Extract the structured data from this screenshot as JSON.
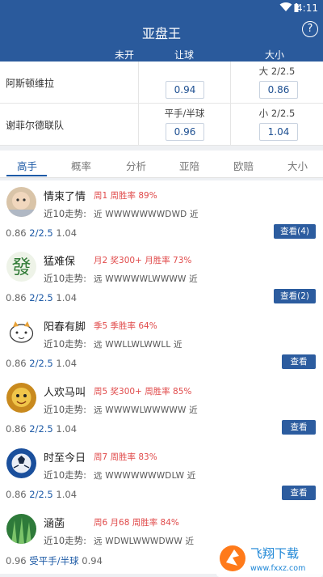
{
  "status": {
    "time": "4:11"
  },
  "app": {
    "title": "亚盘王",
    "help": "?"
  },
  "odds_table": {
    "headers": {
      "not_started": "未开",
      "handicap": "让球",
      "over_under": "大小"
    },
    "rows": [
      {
        "team": "阿斯顿维拉",
        "handicap_label": "",
        "handicap_value": "0.94",
        "ou_label": "大 2/2.5",
        "ou_value": "0.86"
      },
      {
        "team": "谢菲尔德联队",
        "handicap_label": "平手/半球",
        "handicap_value": "0.96",
        "ou_label": "小 2/2.5",
        "ou_value": "1.04"
      }
    ]
  },
  "tabs": [
    {
      "label": "高手",
      "active": true
    },
    {
      "label": "概率",
      "active": false
    },
    {
      "label": "分析",
      "active": false
    },
    {
      "label": "亚陪",
      "active": false
    },
    {
      "label": "欧赔",
      "active": false
    },
    {
      "label": "大小",
      "active": false
    }
  ],
  "experts": [
    {
      "name": "情束了情",
      "record": "周1 周胜率 89%",
      "trend_label": "近10走势:",
      "trend": "近 WWWWWWWDWD 近",
      "odds_left": "0.86",
      "odds_mid": "2/2.5",
      "odds_right": "1.04",
      "button": "查看(4)"
    },
    {
      "name": "猛难保",
      "record": "月2 奖300+ 月胜率 73%",
      "trend_label": "近10走势:",
      "trend": "远 WWWWWLWWWW 近",
      "odds_left": "0.86",
      "odds_mid": "2/2.5",
      "odds_right": "1.04",
      "button": "查看(2)"
    },
    {
      "name": "阳春有脚",
      "record": "季5 季胜率 64%",
      "trend_label": "近10走势:",
      "trend": "远 WWLLWLWWLL 近",
      "odds_left": "0.86",
      "odds_mid": "2/2.5",
      "odds_right": "1.04",
      "button": "查看"
    },
    {
      "name": "人欢马叫",
      "record": "周5 奖300+ 周胜率 85%",
      "trend_label": "近10走势:",
      "trend": "远 WWWWLWWWWW 近",
      "odds_left": "0.86",
      "odds_mid": "2/2.5",
      "odds_right": "1.04",
      "button": "查看"
    },
    {
      "name": "时至今日",
      "record": "周7 周胜率 83%",
      "trend_label": "近10走势:",
      "trend": "远 WWWWWWWDLW 近",
      "odds_left": "0.86",
      "odds_mid": "2/2.5",
      "odds_right": "1.04",
      "button": "查看"
    },
    {
      "name": "涵菡",
      "record": "周6 月68 周胜率 84%",
      "trend_label": "近10走势:",
      "trend": "远 WDWLWWWDWW 近",
      "odds_left": "0.96",
      "odds_mid": "受平手/半球",
      "odds_right": "0.94",
      "button": ""
    }
  ],
  "watermark": {
    "text": "飞翔下载",
    "url": "www.fxxz.com"
  },
  "colors": {
    "primary": "#2a5a9c",
    "accent_red": "#e04a4a",
    "link_blue": "#1d5aa6"
  }
}
